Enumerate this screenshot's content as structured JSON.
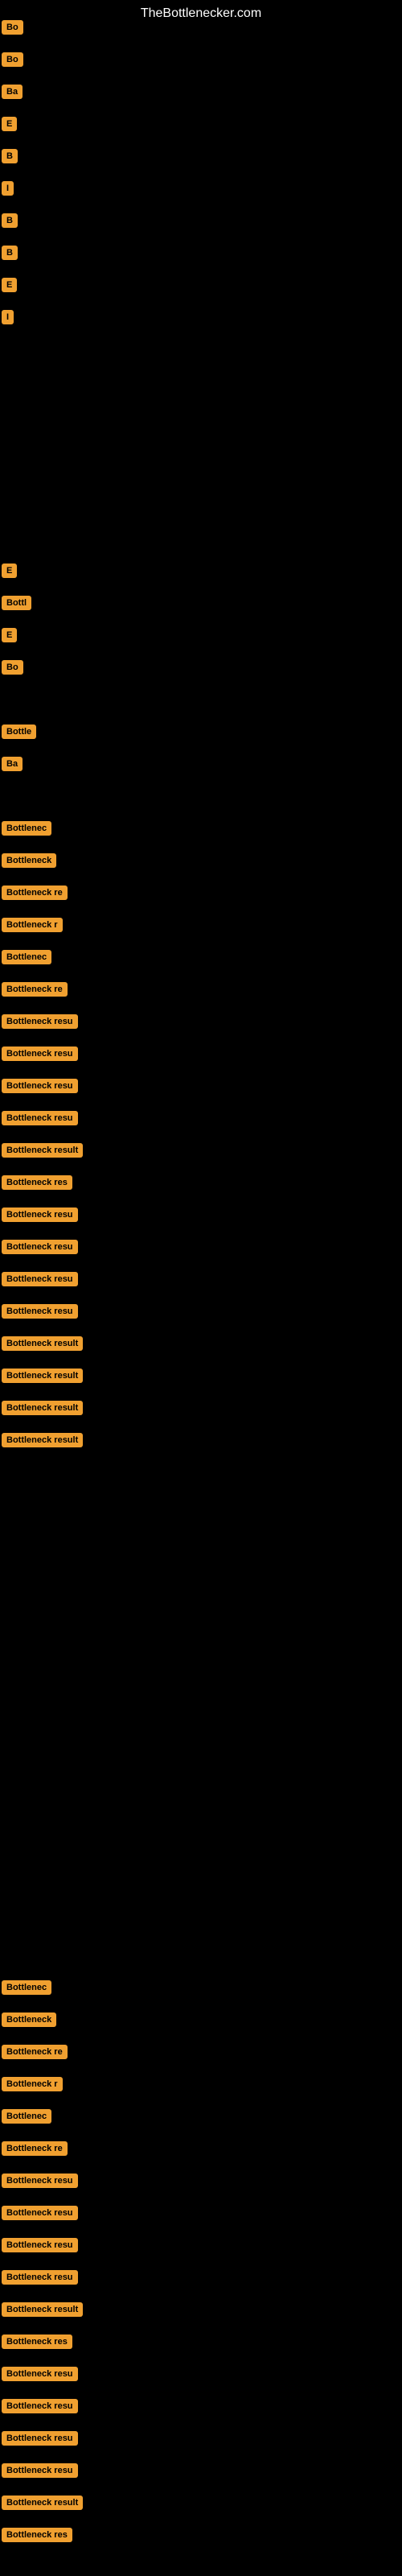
{
  "site": {
    "title": "TheBottlenecker.com"
  },
  "buttons": {
    "btn_color": "#f0a030",
    "rows": [
      {
        "label": "Bo",
        "row": "row-1"
      },
      {
        "label": "Bo",
        "row": "row-2"
      },
      {
        "label": "Ba",
        "row": "row-3"
      },
      {
        "label": "E",
        "row": "row-4"
      },
      {
        "label": "B",
        "row": "row-5"
      },
      {
        "label": "I",
        "row": "row-6"
      },
      {
        "label": "B",
        "row": "row-7"
      },
      {
        "label": "B",
        "row": "row-8"
      },
      {
        "label": "E",
        "row": "row-9"
      },
      {
        "label": "I",
        "row": "row-10"
      }
    ],
    "extra": [
      {
        "label": "E",
        "row": "row-e1"
      },
      {
        "label": "Bottl",
        "row": "row-e2"
      },
      {
        "label": "E",
        "row": "row-e3"
      },
      {
        "label": "Bo",
        "row": "row-e4"
      }
    ],
    "b_rows": [
      {
        "label": "Bottle",
        "row": "row-b1"
      },
      {
        "label": "Ba",
        "row": "row-b2"
      }
    ],
    "c_rows": [
      {
        "label": "Bottlenec",
        "row": "row-c1"
      },
      {
        "label": "Bottleneck",
        "row": "row-c2"
      },
      {
        "label": "Bottleneck re",
        "row": "row-c3"
      },
      {
        "label": "Bottleneck r",
        "row": "row-c4"
      },
      {
        "label": "Bottlenec",
        "row": "row-c5"
      },
      {
        "label": "Bottleneck re",
        "row": "row-c6"
      },
      {
        "label": "Bottleneck resu",
        "row": "row-c7"
      },
      {
        "label": "Bottleneck resu",
        "row": "row-c8"
      },
      {
        "label": "Bottleneck resu",
        "row": "row-c9"
      },
      {
        "label": "Bottleneck resu",
        "row": "row-c10"
      },
      {
        "label": "Bottleneck result",
        "row": "row-c11"
      },
      {
        "label": "Bottleneck res",
        "row": "row-c12"
      },
      {
        "label": "Bottleneck resu",
        "row": "row-c13"
      },
      {
        "label": "Bottleneck resu",
        "row": "row-c14"
      },
      {
        "label": "Bottleneck resu",
        "row": "row-c15"
      },
      {
        "label": "Bottleneck resu",
        "row": "row-c16"
      },
      {
        "label": "Bottleneck result",
        "row": "row-c17"
      },
      {
        "label": "Bottleneck result",
        "row": "row-c18"
      },
      {
        "label": "Bottleneck result",
        "row": "row-c19"
      },
      {
        "label": "Bottleneck result",
        "row": "row-c20"
      }
    ],
    "bn_rows": [
      {
        "label": "Bottlenec",
        "row": "row-bn1"
      },
      {
        "label": "Bottleneck",
        "row": "row-bn2"
      },
      {
        "label": "Bottleneck re",
        "row": "row-bn3"
      },
      {
        "label": "Bottleneck r",
        "row": "row-bn4"
      },
      {
        "label": "Bottlenec",
        "row": "row-bn5"
      },
      {
        "label": "Bottleneck re",
        "row": "row-bn6"
      },
      {
        "label": "Bottleneck resu",
        "row": "row-bn7"
      },
      {
        "label": "Bottleneck resu",
        "row": "row-bn8"
      },
      {
        "label": "Bottleneck resu",
        "row": "row-bn9"
      },
      {
        "label": "Bottleneck resu",
        "row": "row-bn10"
      },
      {
        "label": "Bottleneck result",
        "row": "row-bn11"
      },
      {
        "label": "Bottleneck res",
        "row": "row-bn12"
      },
      {
        "label": "Bottleneck resu",
        "row": "row-bn13"
      },
      {
        "label": "Bottleneck resu",
        "row": "row-bn14"
      },
      {
        "label": "Bottleneck resu",
        "row": "row-bn15"
      },
      {
        "label": "Bottleneck resu",
        "row": "row-bn16"
      },
      {
        "label": "Bottleneck result",
        "row": "row-bn17"
      },
      {
        "label": "Bottleneck res",
        "row": "row-bn18"
      }
    ]
  }
}
